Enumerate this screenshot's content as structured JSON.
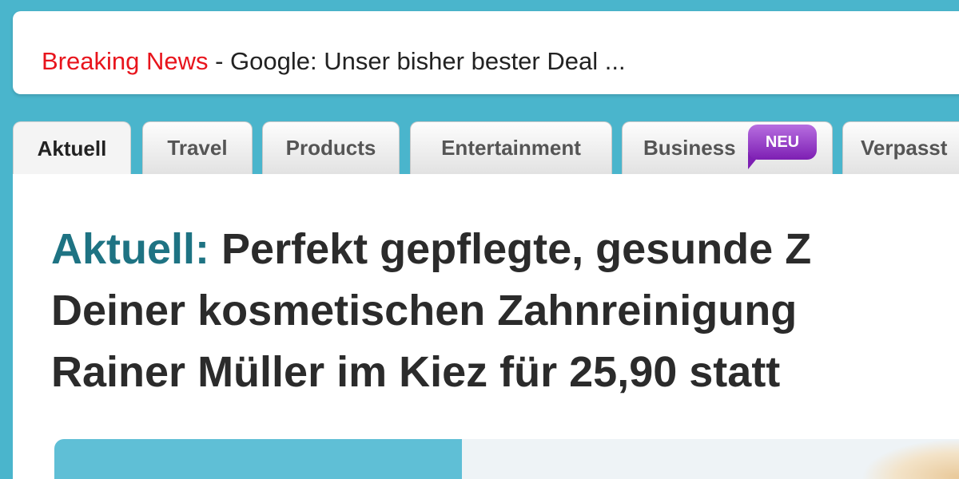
{
  "ticker": {
    "label": "Breaking News",
    "separator": " - ",
    "text": "Google: Unser bisher bester Deal ..."
  },
  "tabs": [
    {
      "label": "Aktuell",
      "active": true
    },
    {
      "label": "Travel"
    },
    {
      "label": "Products"
    },
    {
      "label": "Entertainment"
    },
    {
      "label": "Business",
      "badge": "NEU"
    },
    {
      "label": "Verpasst"
    }
  ],
  "headline": {
    "prefix": "Aktuell:",
    "line1": " Perfekt gepflegte, gesunde Z",
    "line2": "Deiner kosmetischen Zahnreinigung",
    "line3": "Rainer Müller im Kiez für 25,90 statt"
  },
  "colors": {
    "background": "#4ab5cc",
    "breaking": "#e8141c",
    "headline_prefix": "#1e7383",
    "badge": "#8a2fc0"
  }
}
